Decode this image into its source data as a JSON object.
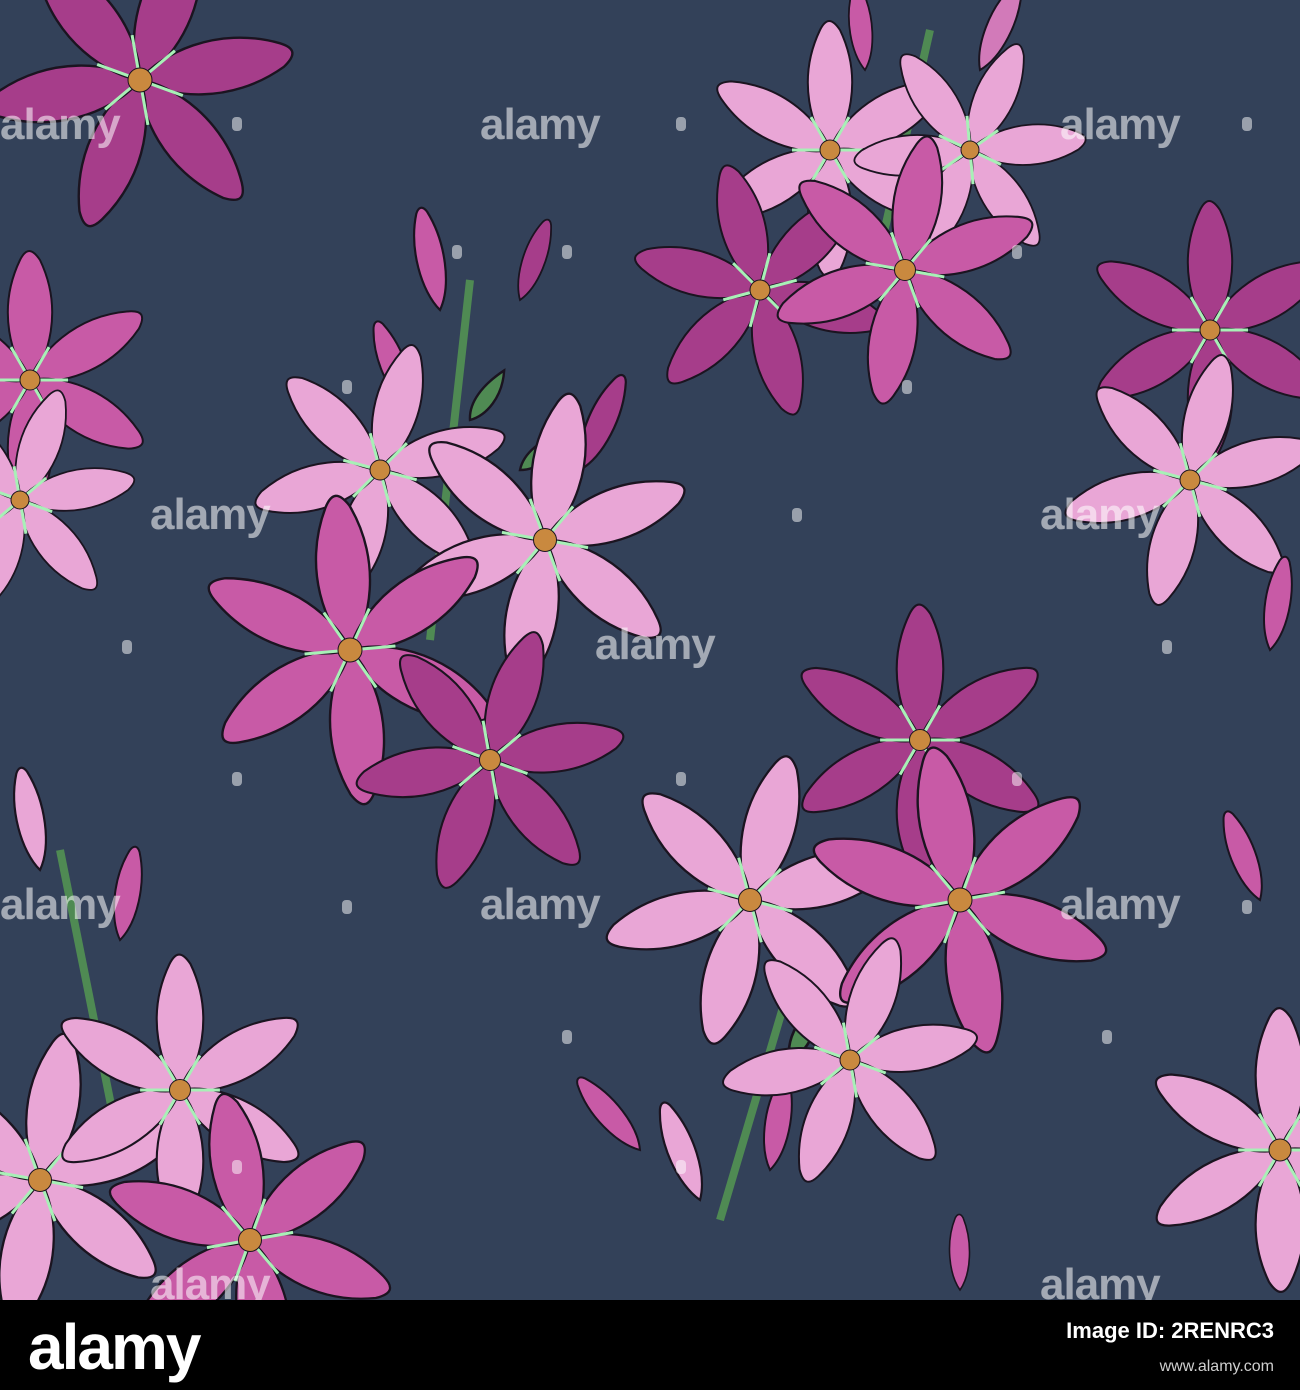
{
  "image": {
    "background_color": "#334159",
    "motif": "pink lily bouquets seamless pattern",
    "petal_colors": [
      "#c85aa6",
      "#a63d8a",
      "#e9a6d6",
      "#d27ab9"
    ],
    "stamen_color": "#a8f0b7",
    "leaf_color": "#4f8a53"
  },
  "watermark": {
    "text": "alamy"
  },
  "footer": {
    "logo": "alamy",
    "id_label": "Image ID: 2RENRC3",
    "url": "www.alamy.com"
  }
}
